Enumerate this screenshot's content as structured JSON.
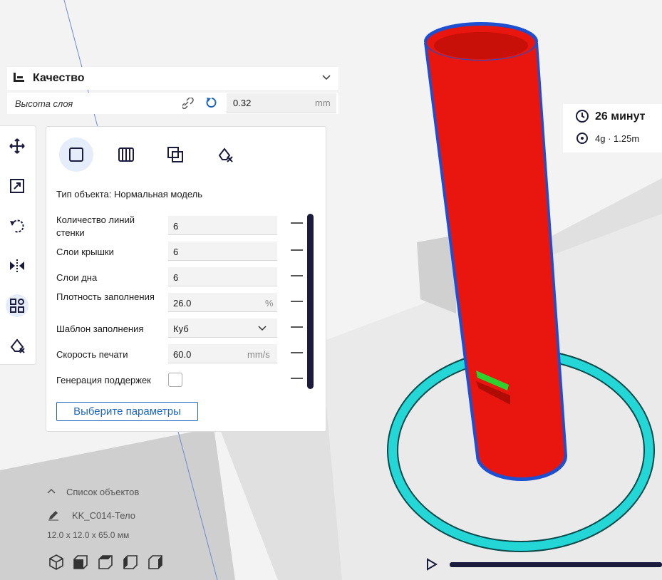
{
  "quality": {
    "title": "Качество",
    "layer_height_label": "Высота слоя",
    "layer_height_value": "0.32",
    "layer_height_unit": "mm"
  },
  "settings": {
    "object_type": "Тип объекта: Нормальная модель",
    "rows": [
      {
        "label": "Количество линий стенки",
        "value": "6",
        "unit": ""
      },
      {
        "label": "Слои крышки",
        "value": "6",
        "unit": ""
      },
      {
        "label": "Слои дна",
        "value": "6",
        "unit": ""
      },
      {
        "label": "Плотность заполнения",
        "value": "26.0",
        "unit": "%"
      },
      {
        "label": "Шаблон заполнения",
        "value": "Куб",
        "unit": ""
      },
      {
        "label": "Скорость печати",
        "value": "60.0",
        "unit": "mm/s"
      },
      {
        "label": "Генерация поддержек",
        "value": "",
        "unit": ""
      }
    ],
    "custom_button": "Выберите параметры"
  },
  "estimate": {
    "time": "26 минут",
    "material": "4g · 1.25m"
  },
  "objects": {
    "list_label": "Список объектов",
    "name": "KK_C014-Тело",
    "dimensions": "12.0 x 12.0 x 65.0 мм"
  },
  "colors": {
    "model": "#e8160f",
    "skirt": "#24d6d6",
    "support": "#2fd12f",
    "accent": "#1e66c0",
    "dark": "#1b1c3d"
  }
}
